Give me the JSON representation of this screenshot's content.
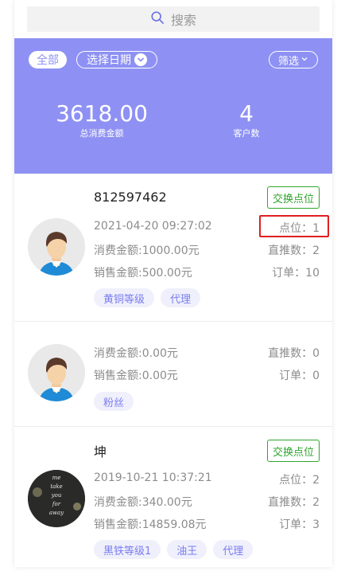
{
  "search": {
    "placeholder": "搜索",
    "icon": "search-icon"
  },
  "summary": {
    "filters": {
      "all": "全部",
      "date": "选择日期",
      "filter": "筛选"
    },
    "total_amount": "3618.00",
    "total_amount_label": "总消费金额",
    "customer_count": "4",
    "customer_count_label": "客户数",
    "bg_color": "#8e91f3"
  },
  "customers": [
    {
      "name": "812597462",
      "exchange_label": "交换点位",
      "date": "2021-04-20 09:27:02",
      "consume": "消费金额:1000.00元",
      "sales": "销售金额:500.00元",
      "point": "点位：1",
      "direct": "直推数：2",
      "orders": "订单：10",
      "tags": [
        "黄铜等级",
        "代理"
      ]
    },
    {
      "consume": "消费金额:0.00元",
      "sales": "销售金额:0.00元",
      "direct": "直推数：0",
      "orders": "订单：0",
      "tags": [
        "粉丝"
      ]
    },
    {
      "name": "坤",
      "exchange_label": "交换点位",
      "date": "2019-10-21 10:37:21",
      "consume": "消费金额:340.00元",
      "sales": "销售金额:14859.08元",
      "point": "点位：2",
      "direct": "直推数：2",
      "orders": "订单：3",
      "tags": [
        "黑铁等级1",
        "油王",
        "代理"
      ],
      "avatar_text": [
        "me",
        "take",
        "you",
        "for",
        "away"
      ]
    }
  ],
  "colors": {
    "accent": "#8e91f3",
    "exchange": "#2fa52f",
    "highlight": "#e02020"
  }
}
